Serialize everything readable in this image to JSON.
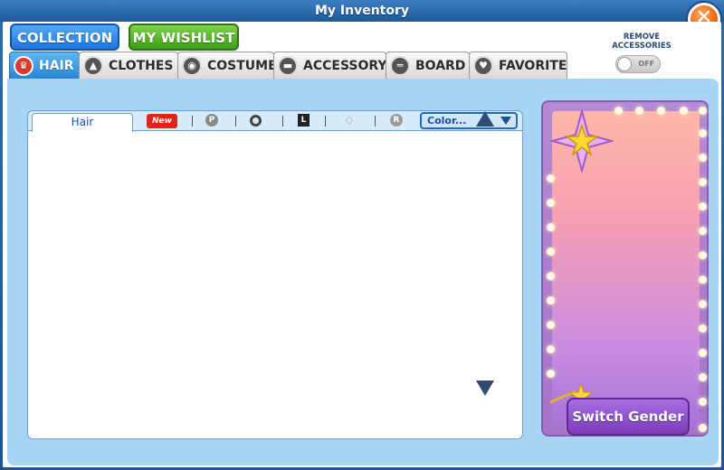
{
  "window": {
    "title": "My Inventory",
    "close_label": "✕"
  },
  "top_tabs": {
    "collection": "COLLECTION",
    "wishlist": "MY WISHLIST"
  },
  "categories": [
    {
      "label": "HAIR",
      "icon": "hair-icon",
      "active": true
    },
    {
      "label": "CLOTHES",
      "icon": "shirt-icon"
    },
    {
      "label": "COSTUME",
      "icon": "costume-icon"
    },
    {
      "label": "ACCESSORY",
      "icon": "sunglasses-icon"
    },
    {
      "label": "BOARD",
      "icon": "board-icon"
    },
    {
      "label": "FAVORITE",
      "icon": "heart-icon"
    }
  ],
  "remove_accessories": {
    "label_line1": "REMOVE",
    "label_line2": "ACCESSORIES",
    "state": "OFF"
  },
  "list": {
    "tab": "Hair",
    "new_badge": "New",
    "filter_p": "P",
    "filter_l": "L",
    "filter_r": "R",
    "color_select": "Color..."
  },
  "preview": {
    "switch_gender": "Switch Gender"
  }
}
